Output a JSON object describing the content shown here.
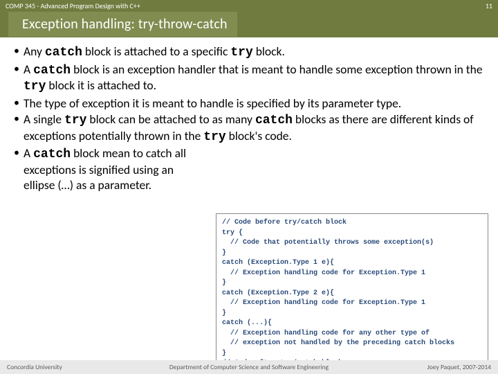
{
  "header": {
    "course": "COMP 345 - Advanced Program Design with C++",
    "page": "11"
  },
  "title": "Exception handling: try-throw-catch",
  "bullets": [
    {
      "parts": [
        {
          "t": "Any "
        },
        {
          "t": "catch",
          "code": true
        },
        {
          "t": " block is attached to a specific "
        },
        {
          "t": "try",
          "code": true
        },
        {
          "t": " block."
        }
      ]
    },
    {
      "parts": [
        {
          "t": "A "
        },
        {
          "t": "catch",
          "code": true
        },
        {
          "t": " block is an exception handler that is meant to handle some exception thrown in the "
        },
        {
          "t": "try",
          "code": true
        },
        {
          "t": " block it is attached to."
        }
      ]
    },
    {
      "parts": [
        {
          "t": "The type of exception it is meant to handle is specified by its parameter type."
        }
      ]
    },
    {
      "parts": [
        {
          "t": "A single "
        },
        {
          "t": "try",
          "code": true
        },
        {
          "t": " block can be attached to as many "
        },
        {
          "t": "catch",
          "code": true
        },
        {
          "t": " blocks as there are different kinds of exceptions potentially thrown in the "
        },
        {
          "t": "try",
          "code": true
        },
        {
          "t": " block's code."
        }
      ]
    },
    {
      "parts": [
        {
          "t": "A "
        },
        {
          "t": "catch",
          "code": true
        },
        {
          "t": " block mean to catch all exceptions is signified using an ellipse (…) as a parameter."
        }
      ],
      "last": true
    }
  ],
  "code": "// Code before try/catch block\ntry {\n  // Code that potentially throws some exception(s)\n}\ncatch (Exception.Type 1 e){\n  // Exception handling code for Exception.Type 1\n}\ncatch (Exception.Type 2 e){\n  // Exception handling code for Exception.Type 1\n}\ncatch (...){\n  // Exception handling code for any other type of\n  // exception not handled by the preceding catch blocks\n}\n// Code after try/catch block",
  "footer": {
    "left": "Concordia University",
    "center": "Department of Computer Science and Software Engineering",
    "right": "Joey Paquet, 2007-2014"
  }
}
